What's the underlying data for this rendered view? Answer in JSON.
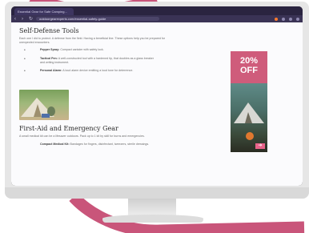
{
  "browser": {
    "tab_title": "Essential Gear for Safe Camping...",
    "url": "outdoorgearexperts.com/essential-safety-guide",
    "nav_back": "‹",
    "nav_forward": "›",
    "nav_reload": "↻"
  },
  "article": {
    "section1_title": "Self-Defense Tools",
    "section1_intro_line1": "Each one I did to protect. A defense from the field. Having a beneficial line. These options help you be prepared for",
    "section1_intro_line2": "unexpected encounters.",
    "items": [
      {
        "name": "Pepper Spray:",
        "desc": "Compact canister with safety lock."
      },
      {
        "name": "Tactical Pen:",
        "desc": "A well-constructed tool with a hardened tip, that doubles as a glass breaker",
        "desc2": "and writing instrument."
      },
      {
        "name": "Personal Alarm:",
        "desc": "A loud alarm device emitting a loud tone for deterrence."
      }
    ],
    "section2_title": "First-Aid and Emergency Gear",
    "section2_intro": "A small medical kit can be a lifesaver outdoors. Pack up to 1 kit by skill for burns and emergencies.",
    "section2_item_name": "Compact Medical Kit:",
    "section2_item_desc": "Bandages for fingers, disinfectant, tweezers, sterile dressings."
  },
  "ad": {
    "discount_line1": "20%",
    "discount_line2": "OFF",
    "arrow_glyph": "➔"
  },
  "colors": {
    "accent": "#cf5c7b",
    "swoosh": "#c9557a",
    "chrome": "#2a2440"
  }
}
